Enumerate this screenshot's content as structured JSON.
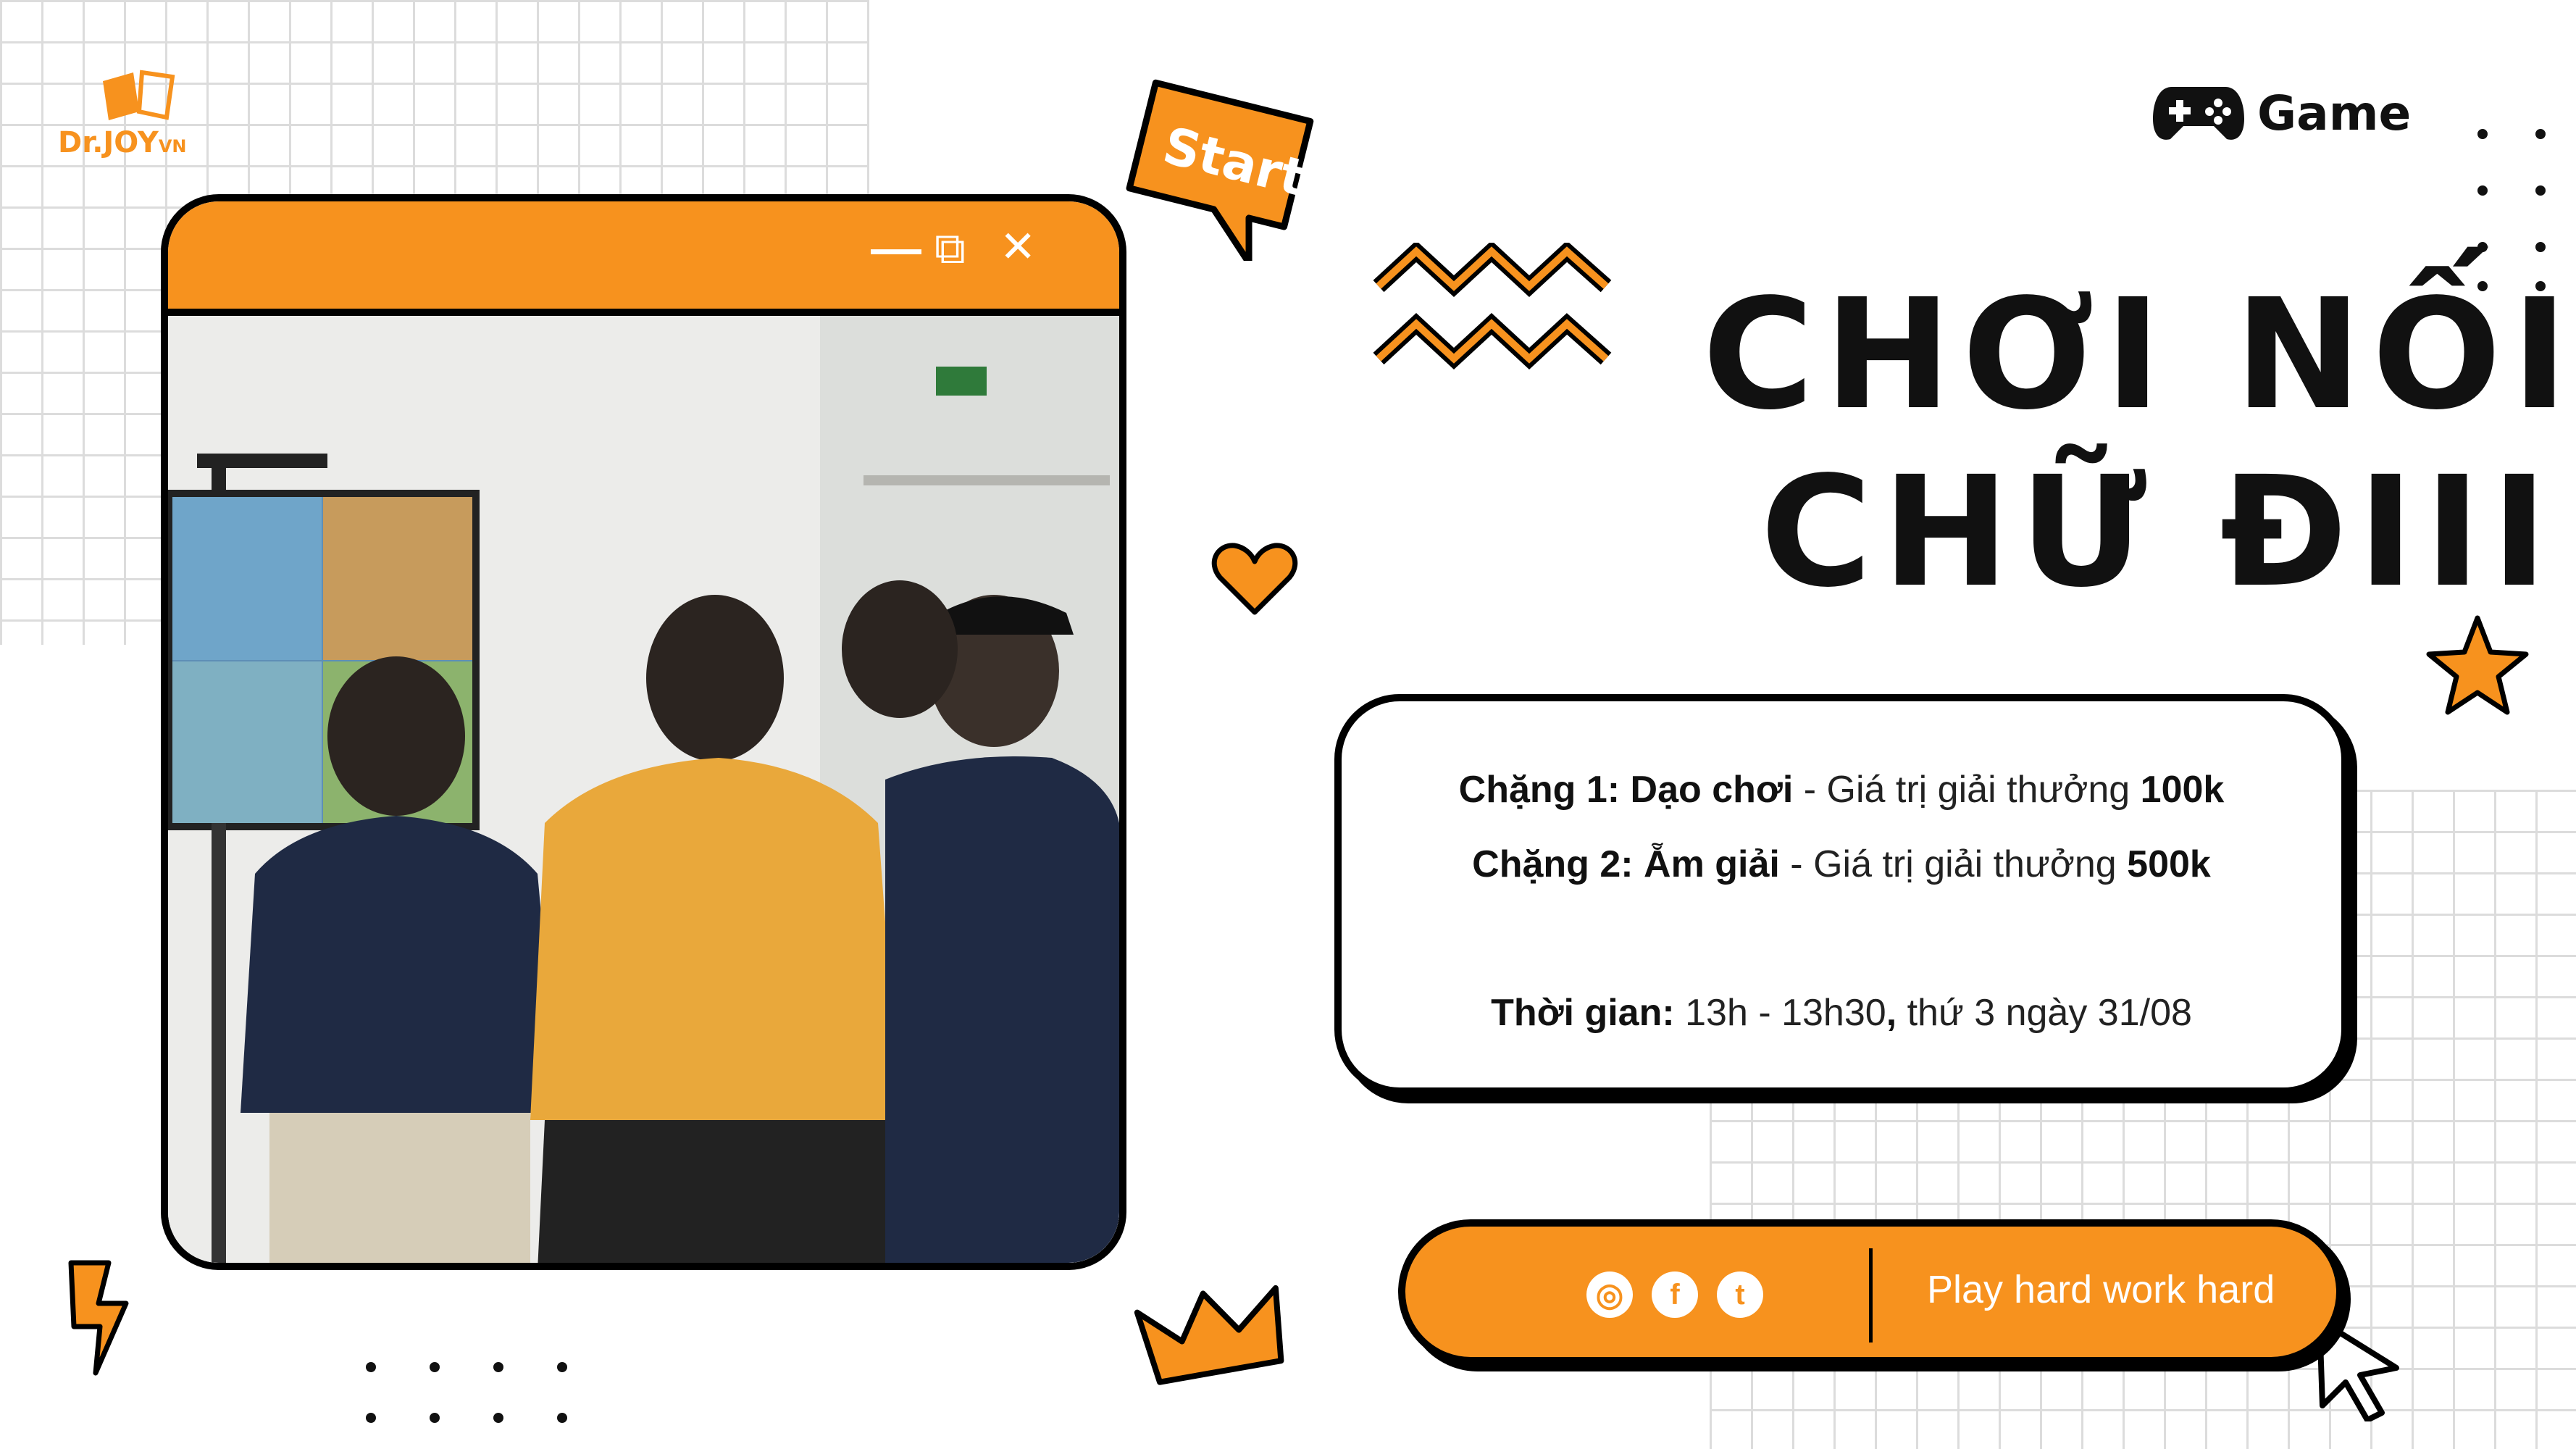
{
  "brand": {
    "logo_text": "Dr.JOY",
    "logo_suffix": "VN"
  },
  "badges": {
    "start": "Start",
    "game": "Game"
  },
  "headline": {
    "line1": "CHƠI NỐI",
    "line2": "CHỮ ĐIII"
  },
  "window_controls": {
    "minimize": "—",
    "restore": "⧉",
    "close": "✕"
  },
  "info": {
    "stage1": {
      "label": "Chặng 1: Dạo chơi",
      "sep": " - Giá trị giải thưởng ",
      "prize": "100k"
    },
    "stage2": {
      "label": "Chặng 2: Ẵm giải",
      "sep": " - Giá trị giải thưởng ",
      "prize": "500k"
    },
    "time": {
      "label": "Thời gian:",
      "value": " 13h - 13h30",
      "comma": ",",
      "rest": " thứ 3 ngày 31/08"
    }
  },
  "footer": {
    "social": {
      "instagram": "◎",
      "facebook": "f",
      "twitter": "t"
    },
    "slogan": "Play hard work hard"
  },
  "colors": {
    "accent": "#f7921e",
    "ink": "#111111",
    "grid": "#dcdcdc"
  }
}
